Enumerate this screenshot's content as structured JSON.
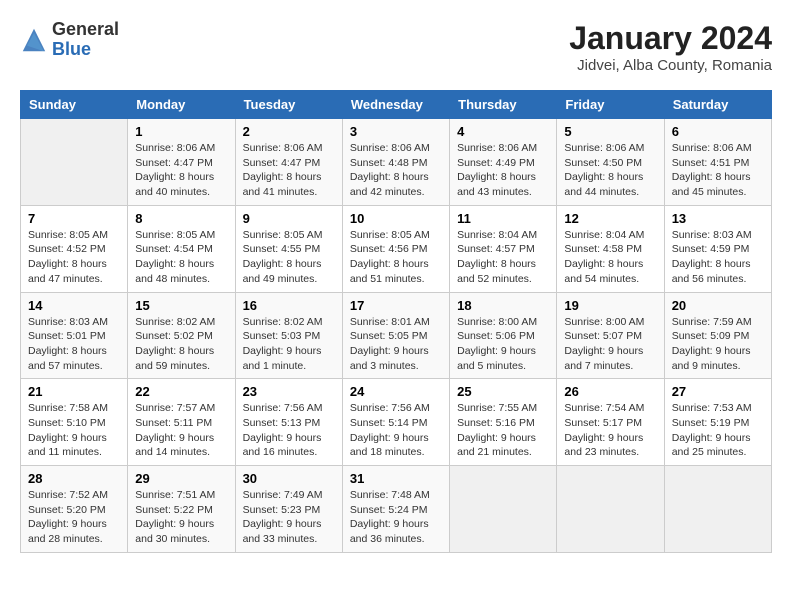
{
  "header": {
    "logo_general": "General",
    "logo_blue": "Blue",
    "month_year": "January 2024",
    "location": "Jidvei, Alba County, Romania"
  },
  "weekdays": [
    "Sunday",
    "Monday",
    "Tuesday",
    "Wednesday",
    "Thursday",
    "Friday",
    "Saturday"
  ],
  "weeks": [
    [
      {
        "day": "",
        "sunrise": "",
        "sunset": "",
        "daylight": ""
      },
      {
        "day": "1",
        "sunrise": "Sunrise: 8:06 AM",
        "sunset": "Sunset: 4:47 PM",
        "daylight": "Daylight: 8 hours and 40 minutes."
      },
      {
        "day": "2",
        "sunrise": "Sunrise: 8:06 AM",
        "sunset": "Sunset: 4:47 PM",
        "daylight": "Daylight: 8 hours and 41 minutes."
      },
      {
        "day": "3",
        "sunrise": "Sunrise: 8:06 AM",
        "sunset": "Sunset: 4:48 PM",
        "daylight": "Daylight: 8 hours and 42 minutes."
      },
      {
        "day": "4",
        "sunrise": "Sunrise: 8:06 AM",
        "sunset": "Sunset: 4:49 PM",
        "daylight": "Daylight: 8 hours and 43 minutes."
      },
      {
        "day": "5",
        "sunrise": "Sunrise: 8:06 AM",
        "sunset": "Sunset: 4:50 PM",
        "daylight": "Daylight: 8 hours and 44 minutes."
      },
      {
        "day": "6",
        "sunrise": "Sunrise: 8:06 AM",
        "sunset": "Sunset: 4:51 PM",
        "daylight": "Daylight: 8 hours and 45 minutes."
      }
    ],
    [
      {
        "day": "7",
        "sunrise": "Sunrise: 8:05 AM",
        "sunset": "Sunset: 4:52 PM",
        "daylight": "Daylight: 8 hours and 47 minutes."
      },
      {
        "day": "8",
        "sunrise": "Sunrise: 8:05 AM",
        "sunset": "Sunset: 4:54 PM",
        "daylight": "Daylight: 8 hours and 48 minutes."
      },
      {
        "day": "9",
        "sunrise": "Sunrise: 8:05 AM",
        "sunset": "Sunset: 4:55 PM",
        "daylight": "Daylight: 8 hours and 49 minutes."
      },
      {
        "day": "10",
        "sunrise": "Sunrise: 8:05 AM",
        "sunset": "Sunset: 4:56 PM",
        "daylight": "Daylight: 8 hours and 51 minutes."
      },
      {
        "day": "11",
        "sunrise": "Sunrise: 8:04 AM",
        "sunset": "Sunset: 4:57 PM",
        "daylight": "Daylight: 8 hours and 52 minutes."
      },
      {
        "day": "12",
        "sunrise": "Sunrise: 8:04 AM",
        "sunset": "Sunset: 4:58 PM",
        "daylight": "Daylight: 8 hours and 54 minutes."
      },
      {
        "day": "13",
        "sunrise": "Sunrise: 8:03 AM",
        "sunset": "Sunset: 4:59 PM",
        "daylight": "Daylight: 8 hours and 56 minutes."
      }
    ],
    [
      {
        "day": "14",
        "sunrise": "Sunrise: 8:03 AM",
        "sunset": "Sunset: 5:01 PM",
        "daylight": "Daylight: 8 hours and 57 minutes."
      },
      {
        "day": "15",
        "sunrise": "Sunrise: 8:02 AM",
        "sunset": "Sunset: 5:02 PM",
        "daylight": "Daylight: 8 hours and 59 minutes."
      },
      {
        "day": "16",
        "sunrise": "Sunrise: 8:02 AM",
        "sunset": "Sunset: 5:03 PM",
        "daylight": "Daylight: 9 hours and 1 minute."
      },
      {
        "day": "17",
        "sunrise": "Sunrise: 8:01 AM",
        "sunset": "Sunset: 5:05 PM",
        "daylight": "Daylight: 9 hours and 3 minutes."
      },
      {
        "day": "18",
        "sunrise": "Sunrise: 8:00 AM",
        "sunset": "Sunset: 5:06 PM",
        "daylight": "Daylight: 9 hours and 5 minutes."
      },
      {
        "day": "19",
        "sunrise": "Sunrise: 8:00 AM",
        "sunset": "Sunset: 5:07 PM",
        "daylight": "Daylight: 9 hours and 7 minutes."
      },
      {
        "day": "20",
        "sunrise": "Sunrise: 7:59 AM",
        "sunset": "Sunset: 5:09 PM",
        "daylight": "Daylight: 9 hours and 9 minutes."
      }
    ],
    [
      {
        "day": "21",
        "sunrise": "Sunrise: 7:58 AM",
        "sunset": "Sunset: 5:10 PM",
        "daylight": "Daylight: 9 hours and 11 minutes."
      },
      {
        "day": "22",
        "sunrise": "Sunrise: 7:57 AM",
        "sunset": "Sunset: 5:11 PM",
        "daylight": "Daylight: 9 hours and 14 minutes."
      },
      {
        "day": "23",
        "sunrise": "Sunrise: 7:56 AM",
        "sunset": "Sunset: 5:13 PM",
        "daylight": "Daylight: 9 hours and 16 minutes."
      },
      {
        "day": "24",
        "sunrise": "Sunrise: 7:56 AM",
        "sunset": "Sunset: 5:14 PM",
        "daylight": "Daylight: 9 hours and 18 minutes."
      },
      {
        "day": "25",
        "sunrise": "Sunrise: 7:55 AM",
        "sunset": "Sunset: 5:16 PM",
        "daylight": "Daylight: 9 hours and 21 minutes."
      },
      {
        "day": "26",
        "sunrise": "Sunrise: 7:54 AM",
        "sunset": "Sunset: 5:17 PM",
        "daylight": "Daylight: 9 hours and 23 minutes."
      },
      {
        "day": "27",
        "sunrise": "Sunrise: 7:53 AM",
        "sunset": "Sunset: 5:19 PM",
        "daylight": "Daylight: 9 hours and 25 minutes."
      }
    ],
    [
      {
        "day": "28",
        "sunrise": "Sunrise: 7:52 AM",
        "sunset": "Sunset: 5:20 PM",
        "daylight": "Daylight: 9 hours and 28 minutes."
      },
      {
        "day": "29",
        "sunrise": "Sunrise: 7:51 AM",
        "sunset": "Sunset: 5:22 PM",
        "daylight": "Daylight: 9 hours and 30 minutes."
      },
      {
        "day": "30",
        "sunrise": "Sunrise: 7:49 AM",
        "sunset": "Sunset: 5:23 PM",
        "daylight": "Daylight: 9 hours and 33 minutes."
      },
      {
        "day": "31",
        "sunrise": "Sunrise: 7:48 AM",
        "sunset": "Sunset: 5:24 PM",
        "daylight": "Daylight: 9 hours and 36 minutes."
      },
      {
        "day": "",
        "sunrise": "",
        "sunset": "",
        "daylight": ""
      },
      {
        "day": "",
        "sunrise": "",
        "sunset": "",
        "daylight": ""
      },
      {
        "day": "",
        "sunrise": "",
        "sunset": "",
        "daylight": ""
      }
    ]
  ]
}
